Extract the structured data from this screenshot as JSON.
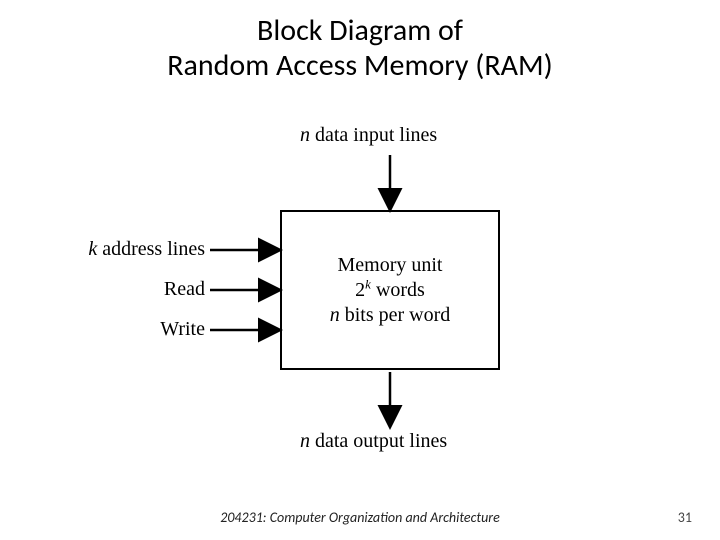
{
  "title_line1": "Block Diagram of",
  "title_line2": "Random Access Memory (RAM)",
  "top_label_prefix_html": "<i>n</i> data input lines",
  "bottom_label_prefix_html": "<i>n</i> data output lines",
  "left_label1_html": "<i>k</i> address lines",
  "left_label2": "Read",
  "left_label3": "Write",
  "box_line1": "Memory unit",
  "box_line2_html": "2<sup><i>k</i></sup> words",
  "box_line3_html": "<i>n</i> bits per word",
  "footer": "204231: Computer Organization and Architecture",
  "page_number": "31",
  "diagram_meta": {
    "type": "block-diagram",
    "block": "Memory unit (2^k words, n bits/word)",
    "inputs": [
      {
        "name": "n data input lines",
        "side": "top"
      },
      {
        "name": "k address lines",
        "side": "left"
      },
      {
        "name": "Read",
        "side": "left"
      },
      {
        "name": "Write",
        "side": "left"
      }
    ],
    "outputs": [
      {
        "name": "n data output lines",
        "side": "bottom"
      }
    ]
  }
}
